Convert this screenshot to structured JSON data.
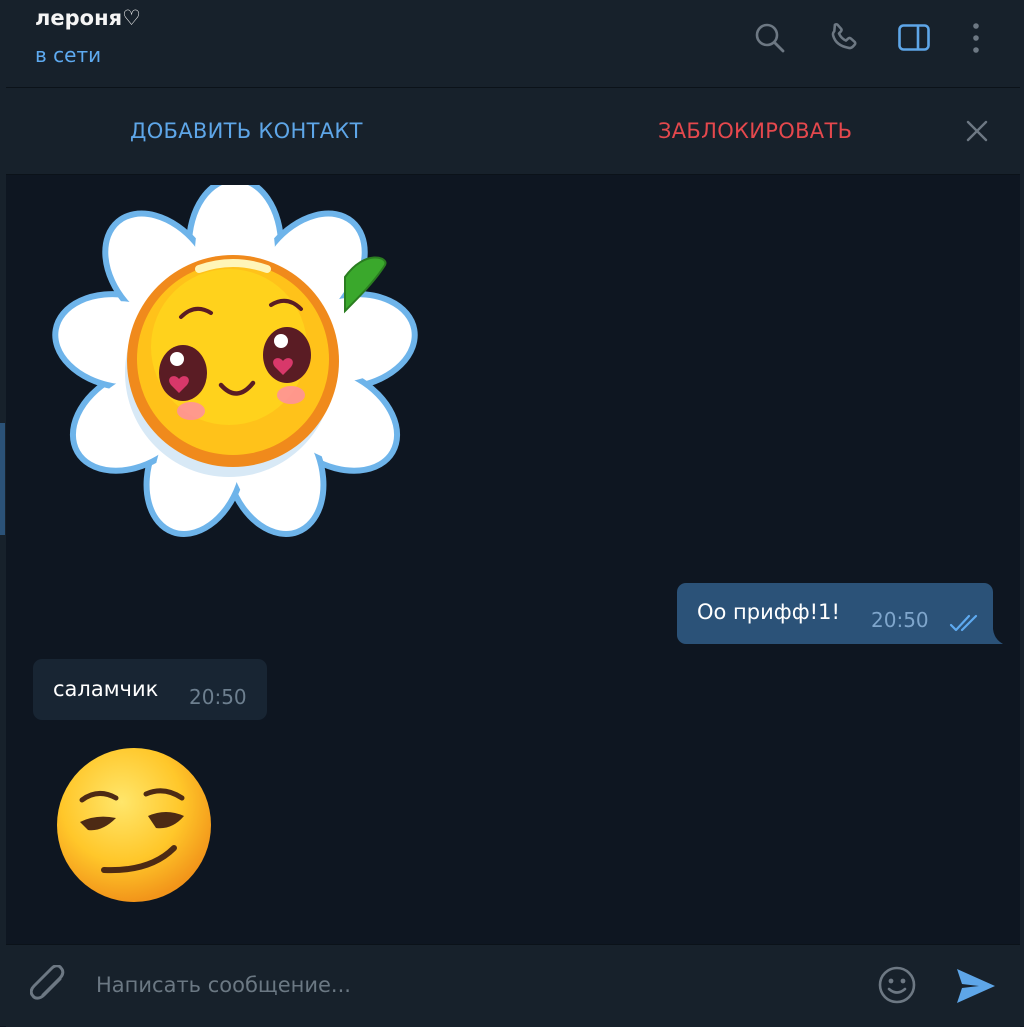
{
  "chat": {
    "title": "лероня♡",
    "status": "в сети"
  },
  "header_icons": [
    "search-icon",
    "phone-icon",
    "sidebar-toggle-icon",
    "more-vertical-icon"
  ],
  "banner": {
    "add_contact": "ДОБАВИТЬ КОНТАКТ",
    "block": "ЗАБЛОКИРОВАТЬ",
    "close_icon": "close-icon"
  },
  "messages": [
    {
      "kind": "sticker",
      "direction": "incoming",
      "sticker": "chamomile-flower-smiley"
    },
    {
      "kind": "text",
      "direction": "outgoing",
      "text": "Оо прифф!1!",
      "time": "20:50",
      "read": true
    },
    {
      "kind": "text",
      "direction": "incoming",
      "text": "саламчик",
      "time": "20:50"
    },
    {
      "kind": "emoji",
      "direction": "incoming",
      "emoji": "smirking-face"
    }
  ],
  "composer": {
    "placeholder": "Написать сообщение...",
    "value": ""
  },
  "colors": {
    "background": "#0e1621",
    "panel": "#17212b",
    "outgoing_bubble": "#2b5278",
    "incoming_bubble": "#182533",
    "accent": "#5ea6e8",
    "danger": "#e5484d",
    "status_online": "#5eaaf0"
  }
}
